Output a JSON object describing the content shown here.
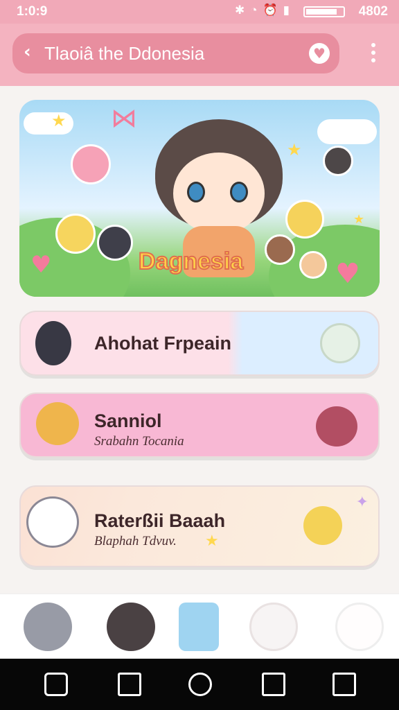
{
  "status_bar": {
    "time": "1:0:9",
    "battery_text": "4802",
    "icons": [
      "bluetooth-icon",
      "wifi-icon",
      "alarm-icon",
      "signal-icon"
    ]
  },
  "app_bar": {
    "title": "Tlaoiâ the Ddonesia",
    "back_icon": "back-arrow-icon",
    "favorite_icon": "heart-icon",
    "menu_icon": "more-vertical-icon"
  },
  "banner": {
    "title": "Dagnesia"
  },
  "cards": [
    {
      "title": "Ahohat Frpeain"
    },
    {
      "title": "Sanniol",
      "subtitle": "Srabahn Tocania"
    },
    {
      "title": "Raterßii Baaah",
      "subtitle": "Blaphah Tdvuv."
    }
  ],
  "bottom_nav": [
    "character-icon",
    "pet-icon",
    "card-icon",
    "cat-icon",
    "ghost-icon"
  ],
  "colors": {
    "status_pink": "#f1a9b8",
    "appbar_pink": "#f4b3c0",
    "search_pink": "#e88e9f",
    "card1_left": "#fde0e8",
    "card1_right": "#dceeff",
    "card2": "#f8b8d4",
    "card3": "#fbe8db"
  }
}
